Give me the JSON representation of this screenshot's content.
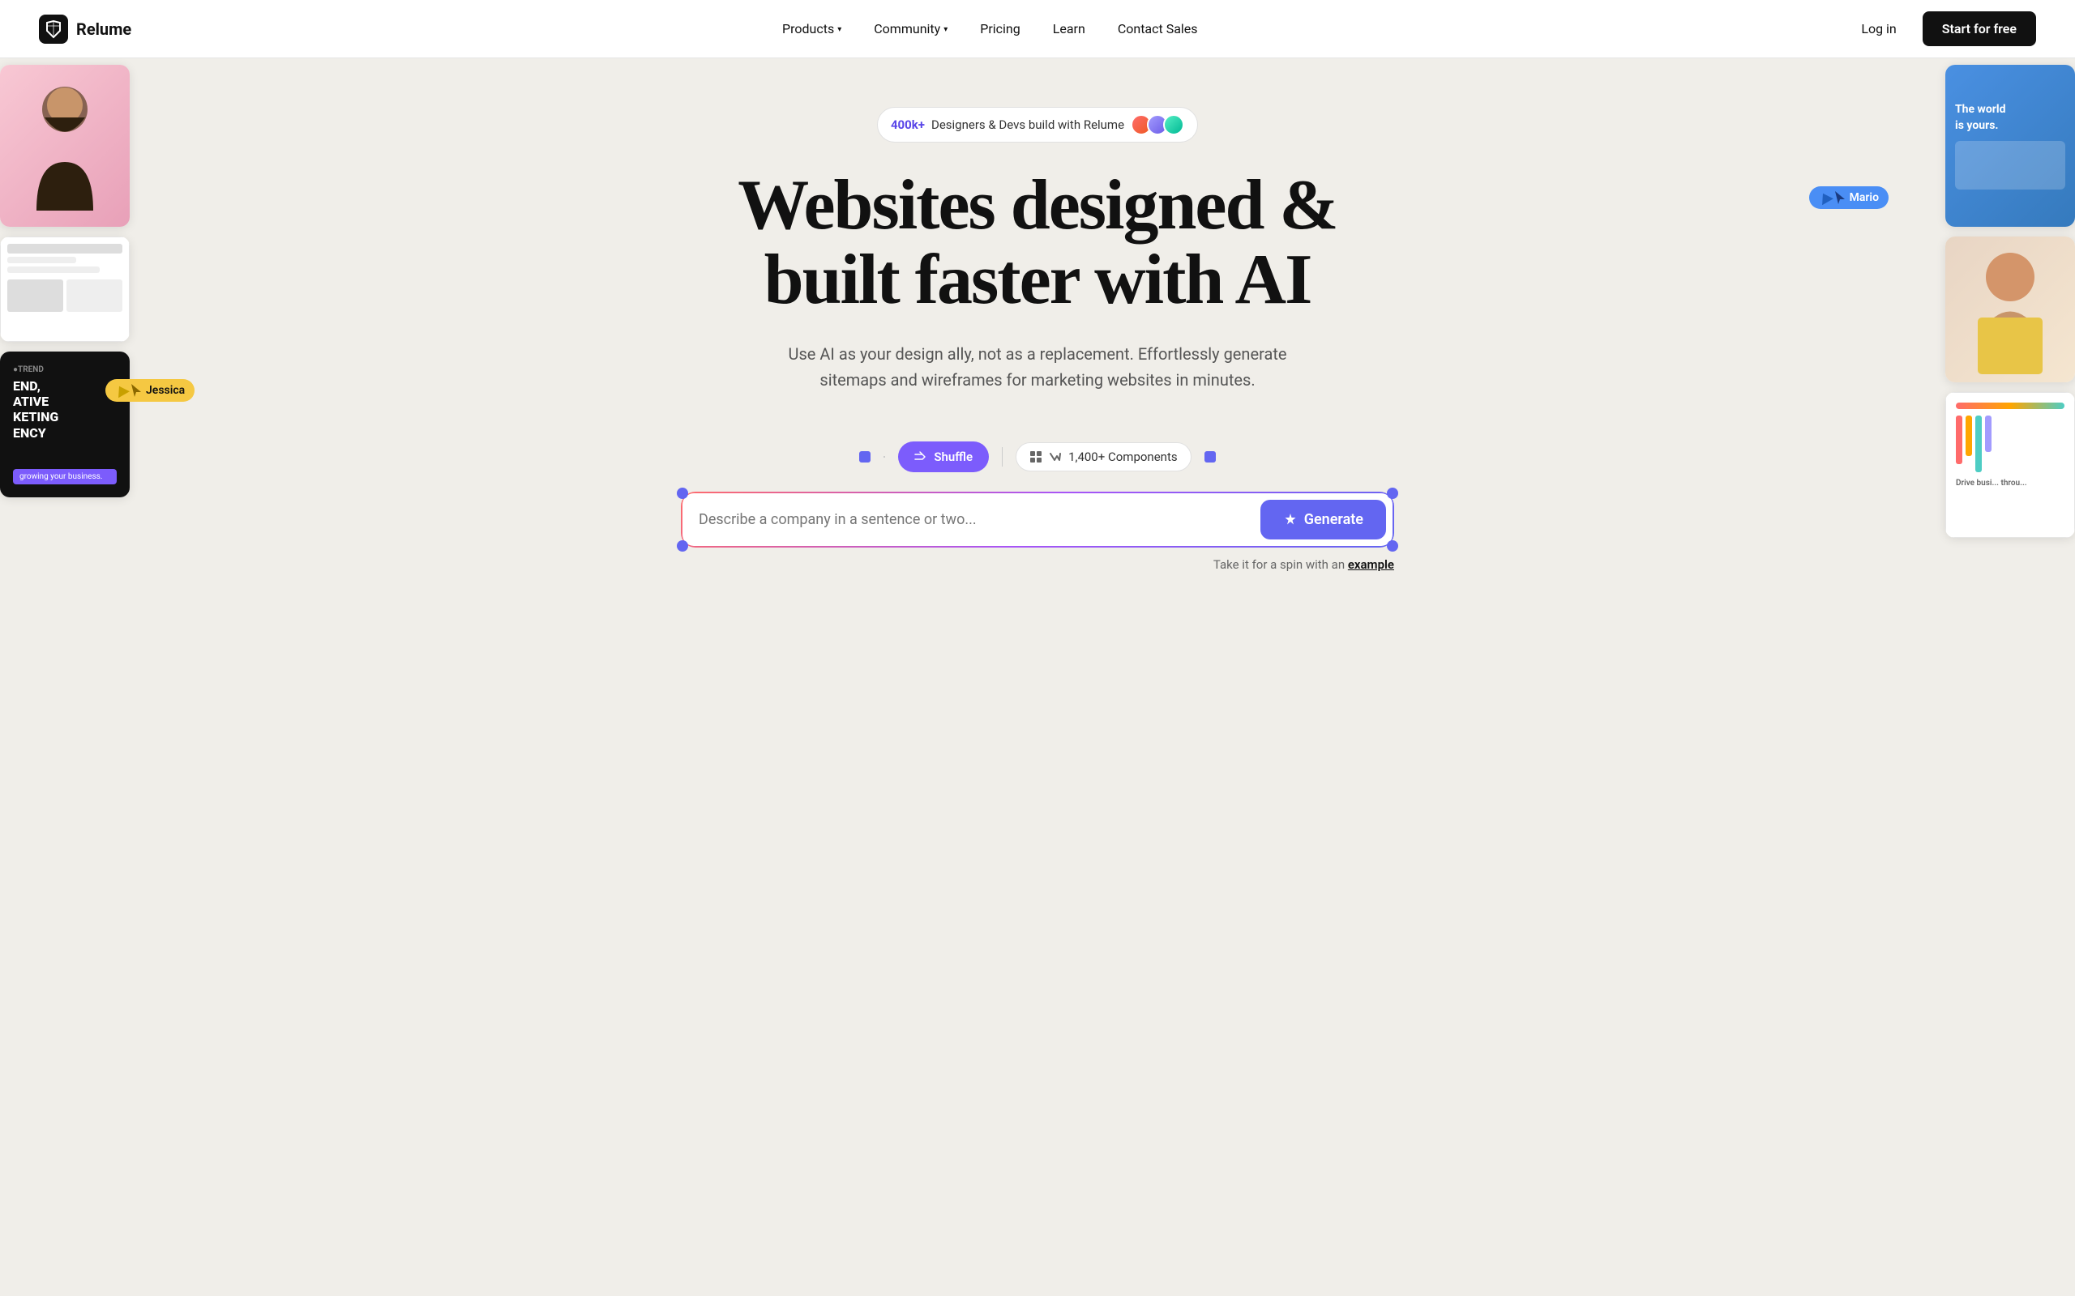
{
  "nav": {
    "logo_text": "Relume",
    "links": [
      {
        "label": "Products",
        "has_dropdown": true
      },
      {
        "label": "Community",
        "has_dropdown": true
      },
      {
        "label": "Pricing",
        "has_dropdown": false
      },
      {
        "label": "Learn",
        "has_dropdown": false
      },
      {
        "label": "Contact Sales",
        "has_dropdown": false
      }
    ],
    "login_label": "Log in",
    "cta_label": "Start for free"
  },
  "hero": {
    "badge_count": "400k+",
    "badge_text": "Designers & Devs build with Relume",
    "title_line1": "Websites designed &",
    "title_line2": "built faster with AI",
    "subtitle": "Use AI as your design ally, not as a replacement. Effortlessly generate sitemaps and wireframes for marketing websites in minutes.",
    "shuffle_label": "Shuffle",
    "components_label": "1,400+ Components",
    "cursor_jessica": "Jessica",
    "cursor_mario": "Mario",
    "input_placeholder": "Describe a company in a sentence or two...",
    "generate_label": "Generate",
    "hint_text": "Take it for a spin with an",
    "hint_link": "example"
  }
}
